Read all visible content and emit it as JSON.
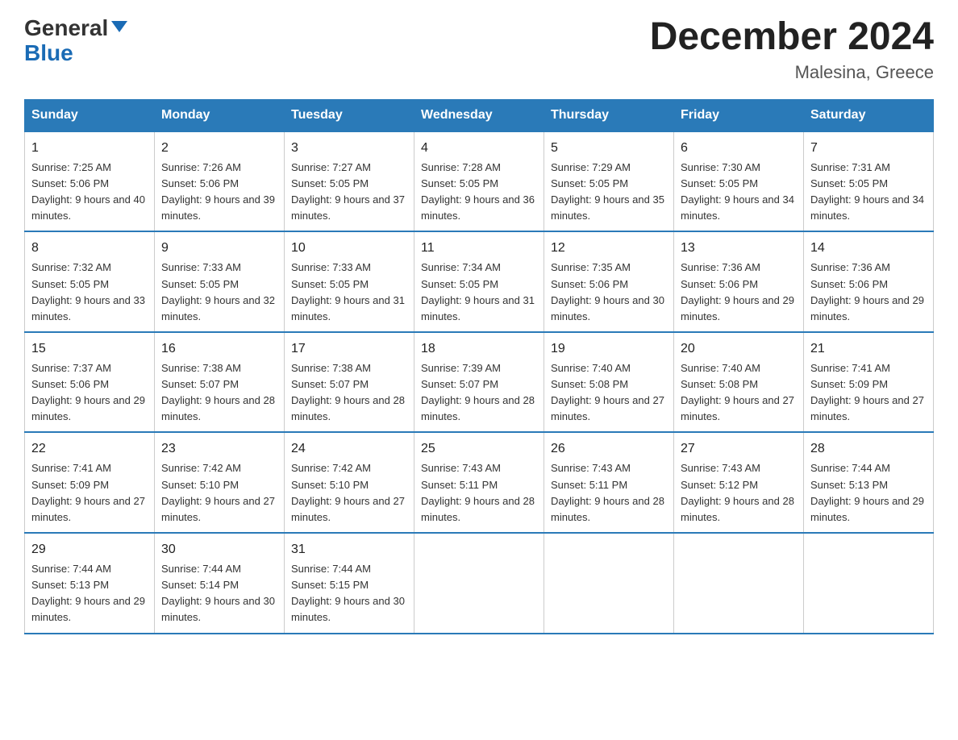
{
  "header": {
    "logo_general": "General",
    "logo_blue": "Blue",
    "month_year": "December 2024",
    "location": "Malesina, Greece"
  },
  "days_of_week": [
    "Sunday",
    "Monday",
    "Tuesday",
    "Wednesday",
    "Thursday",
    "Friday",
    "Saturday"
  ],
  "weeks": [
    [
      {
        "day": "1",
        "sunrise": "7:25 AM",
        "sunset": "5:06 PM",
        "daylight": "9 hours and 40 minutes."
      },
      {
        "day": "2",
        "sunrise": "7:26 AM",
        "sunset": "5:06 PM",
        "daylight": "9 hours and 39 minutes."
      },
      {
        "day": "3",
        "sunrise": "7:27 AM",
        "sunset": "5:05 PM",
        "daylight": "9 hours and 37 minutes."
      },
      {
        "day": "4",
        "sunrise": "7:28 AM",
        "sunset": "5:05 PM",
        "daylight": "9 hours and 36 minutes."
      },
      {
        "day": "5",
        "sunrise": "7:29 AM",
        "sunset": "5:05 PM",
        "daylight": "9 hours and 35 minutes."
      },
      {
        "day": "6",
        "sunrise": "7:30 AM",
        "sunset": "5:05 PM",
        "daylight": "9 hours and 34 minutes."
      },
      {
        "day": "7",
        "sunrise": "7:31 AM",
        "sunset": "5:05 PM",
        "daylight": "9 hours and 34 minutes."
      }
    ],
    [
      {
        "day": "8",
        "sunrise": "7:32 AM",
        "sunset": "5:05 PM",
        "daylight": "9 hours and 33 minutes."
      },
      {
        "day": "9",
        "sunrise": "7:33 AM",
        "sunset": "5:05 PM",
        "daylight": "9 hours and 32 minutes."
      },
      {
        "day": "10",
        "sunrise": "7:33 AM",
        "sunset": "5:05 PM",
        "daylight": "9 hours and 31 minutes."
      },
      {
        "day": "11",
        "sunrise": "7:34 AM",
        "sunset": "5:05 PM",
        "daylight": "9 hours and 31 minutes."
      },
      {
        "day": "12",
        "sunrise": "7:35 AM",
        "sunset": "5:06 PM",
        "daylight": "9 hours and 30 minutes."
      },
      {
        "day": "13",
        "sunrise": "7:36 AM",
        "sunset": "5:06 PM",
        "daylight": "9 hours and 29 minutes."
      },
      {
        "day": "14",
        "sunrise": "7:36 AM",
        "sunset": "5:06 PM",
        "daylight": "9 hours and 29 minutes."
      }
    ],
    [
      {
        "day": "15",
        "sunrise": "7:37 AM",
        "sunset": "5:06 PM",
        "daylight": "9 hours and 29 minutes."
      },
      {
        "day": "16",
        "sunrise": "7:38 AM",
        "sunset": "5:07 PM",
        "daylight": "9 hours and 28 minutes."
      },
      {
        "day": "17",
        "sunrise": "7:38 AM",
        "sunset": "5:07 PM",
        "daylight": "9 hours and 28 minutes."
      },
      {
        "day": "18",
        "sunrise": "7:39 AM",
        "sunset": "5:07 PM",
        "daylight": "9 hours and 28 minutes."
      },
      {
        "day": "19",
        "sunrise": "7:40 AM",
        "sunset": "5:08 PM",
        "daylight": "9 hours and 27 minutes."
      },
      {
        "day": "20",
        "sunrise": "7:40 AM",
        "sunset": "5:08 PM",
        "daylight": "9 hours and 27 minutes."
      },
      {
        "day": "21",
        "sunrise": "7:41 AM",
        "sunset": "5:09 PM",
        "daylight": "9 hours and 27 minutes."
      }
    ],
    [
      {
        "day": "22",
        "sunrise": "7:41 AM",
        "sunset": "5:09 PM",
        "daylight": "9 hours and 27 minutes."
      },
      {
        "day": "23",
        "sunrise": "7:42 AM",
        "sunset": "5:10 PM",
        "daylight": "9 hours and 27 minutes."
      },
      {
        "day": "24",
        "sunrise": "7:42 AM",
        "sunset": "5:10 PM",
        "daylight": "9 hours and 27 minutes."
      },
      {
        "day": "25",
        "sunrise": "7:43 AM",
        "sunset": "5:11 PM",
        "daylight": "9 hours and 28 minutes."
      },
      {
        "day": "26",
        "sunrise": "7:43 AM",
        "sunset": "5:11 PM",
        "daylight": "9 hours and 28 minutes."
      },
      {
        "day": "27",
        "sunrise": "7:43 AM",
        "sunset": "5:12 PM",
        "daylight": "9 hours and 28 minutes."
      },
      {
        "day": "28",
        "sunrise": "7:44 AM",
        "sunset": "5:13 PM",
        "daylight": "9 hours and 29 minutes."
      }
    ],
    [
      {
        "day": "29",
        "sunrise": "7:44 AM",
        "sunset": "5:13 PM",
        "daylight": "9 hours and 29 minutes."
      },
      {
        "day": "30",
        "sunrise": "7:44 AM",
        "sunset": "5:14 PM",
        "daylight": "9 hours and 30 minutes."
      },
      {
        "day": "31",
        "sunrise": "7:44 AM",
        "sunset": "5:15 PM",
        "daylight": "9 hours and 30 minutes."
      },
      {
        "day": "",
        "sunrise": "",
        "sunset": "",
        "daylight": ""
      },
      {
        "day": "",
        "sunrise": "",
        "sunset": "",
        "daylight": ""
      },
      {
        "day": "",
        "sunrise": "",
        "sunset": "",
        "daylight": ""
      },
      {
        "day": "",
        "sunrise": "",
        "sunset": "",
        "daylight": ""
      }
    ]
  ],
  "labels": {
    "sunrise": "Sunrise:",
    "sunset": "Sunset:",
    "daylight": "Daylight:"
  }
}
